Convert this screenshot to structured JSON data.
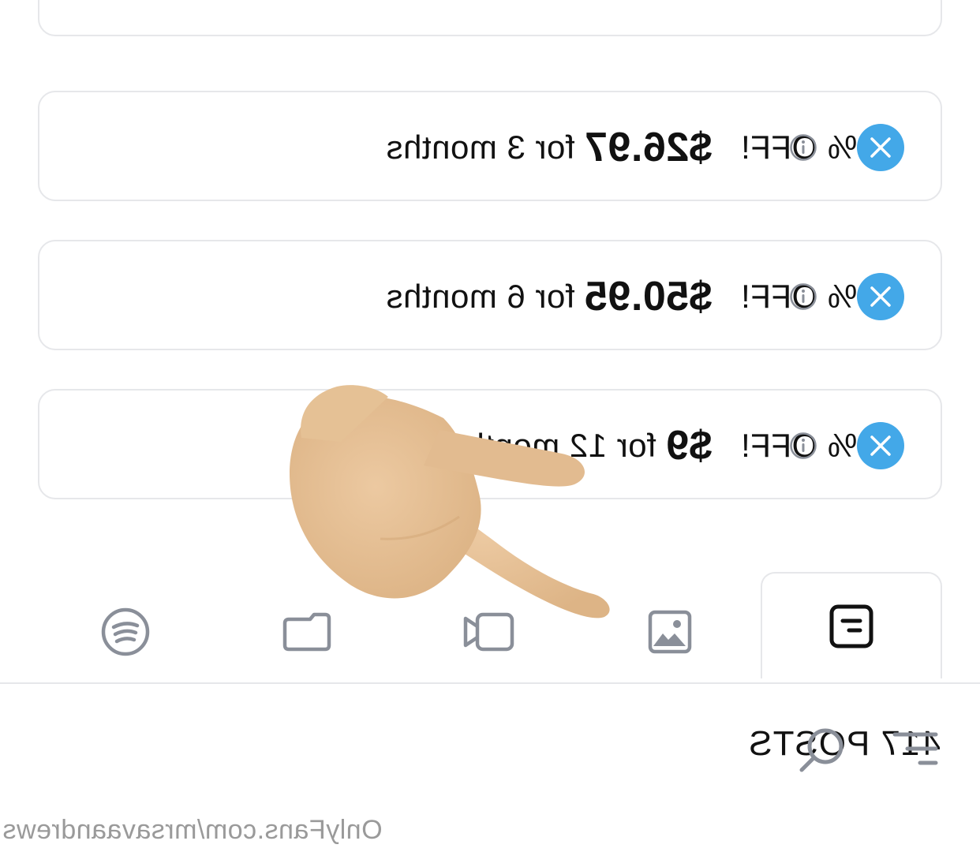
{
  "bundles": [
    {
      "discount": "10% OFF!",
      "price": "$26.97",
      "period": "for 3 months"
    },
    {
      "discount": "15% OFF!",
      "price": "$50.95",
      "period": "for 6 months"
    },
    {
      "discount": "20% OFF!",
      "price": "$9",
      "period": "for 12 months"
    }
  ],
  "tabs": [
    {
      "name": "posts",
      "icon": "posts-icon",
      "active": true
    },
    {
      "name": "photos",
      "icon": "image-icon",
      "active": false
    },
    {
      "name": "videos",
      "icon": "video-icon",
      "active": false
    },
    {
      "name": "archive",
      "icon": "folder-icon",
      "active": false
    },
    {
      "name": "music",
      "icon": "spotify-icon",
      "active": false
    }
  ],
  "posts_count": "417 POSTS",
  "watermark": "OnlyFans.com/mrsavaandrews",
  "colors": {
    "accent": "#43a8e8",
    "border": "#e6e7ea",
    "icon_grey": "#8a8f99",
    "skin": "#e6bf93"
  }
}
